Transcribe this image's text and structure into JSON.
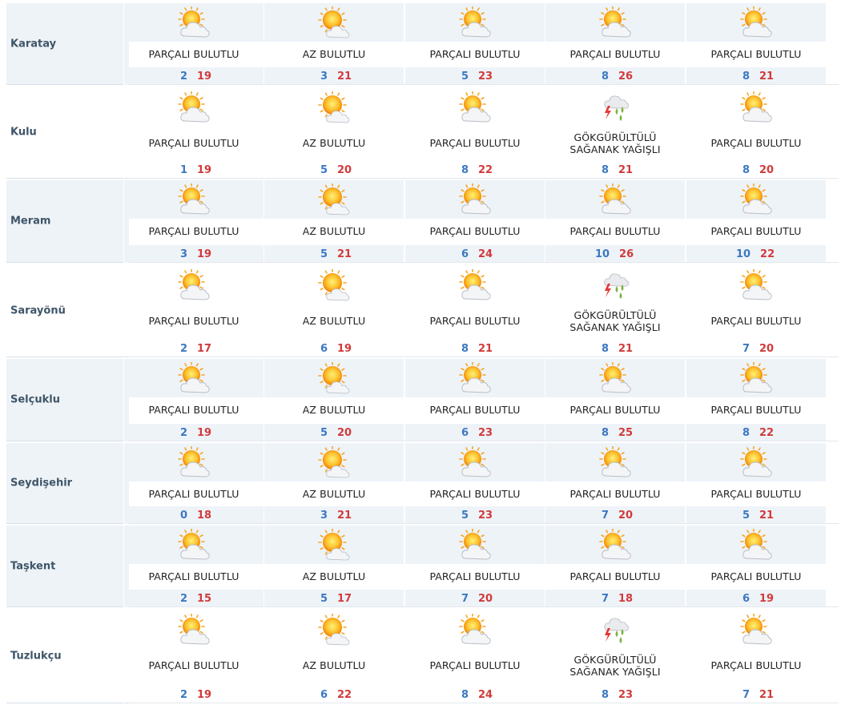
{
  "days_per_row": 5,
  "rows": [
    {
      "city": "Karatay",
      "days": [
        {
          "icon": "partly-cloudy-icon",
          "desc": [
            "PARÇALI BULUTLU"
          ],
          "min": "2",
          "max": "19"
        },
        {
          "icon": "mostly-sunny-icon",
          "desc": [
            "AZ BULUTLU"
          ],
          "min": "3",
          "max": "21"
        },
        {
          "icon": "partly-cloudy-icon",
          "desc": [
            "PARÇALI BULUTLU"
          ],
          "min": "5",
          "max": "23"
        },
        {
          "icon": "partly-cloudy-icon",
          "desc": [
            "PARÇALI BULUTLU"
          ],
          "min": "8",
          "max": "26"
        },
        {
          "icon": "partly-cloudy-icon",
          "desc": [
            "PARÇALI BULUTLU"
          ],
          "min": "8",
          "max": "21"
        }
      ]
    },
    {
      "city": "Kulu",
      "days": [
        {
          "icon": "partly-cloudy-icon",
          "desc": [
            "PARÇALI BULUTLU"
          ],
          "min": "1",
          "max": "19"
        },
        {
          "icon": "mostly-sunny-icon",
          "desc": [
            "AZ BULUTLU"
          ],
          "min": "5",
          "max": "20"
        },
        {
          "icon": "partly-cloudy-icon",
          "desc": [
            "PARÇALI BULUTLU"
          ],
          "min": "8",
          "max": "22"
        },
        {
          "icon": "thunderstorm-icon",
          "desc": [
            "GÖKGÜRÜLTÜLÜ",
            "SAĞANAK YAĞIŞLI"
          ],
          "min": "8",
          "max": "21"
        },
        {
          "icon": "partly-cloudy-icon",
          "desc": [
            "PARÇALI BULUTLU"
          ],
          "min": "8",
          "max": "20"
        }
      ]
    },
    {
      "city": "Meram",
      "days": [
        {
          "icon": "partly-cloudy-icon",
          "desc": [
            "PARÇALI BULUTLU"
          ],
          "min": "3",
          "max": "19"
        },
        {
          "icon": "mostly-sunny-icon",
          "desc": [
            "AZ BULUTLU"
          ],
          "min": "5",
          "max": "21"
        },
        {
          "icon": "partly-cloudy-icon",
          "desc": [
            "PARÇALI BULUTLU"
          ],
          "min": "6",
          "max": "24"
        },
        {
          "icon": "partly-cloudy-icon",
          "desc": [
            "PARÇALI BULUTLU"
          ],
          "min": "10",
          "max": "26"
        },
        {
          "icon": "partly-cloudy-icon",
          "desc": [
            "PARÇALI BULUTLU"
          ],
          "min": "10",
          "max": "22"
        }
      ]
    },
    {
      "city": "Sarayönü",
      "days": [
        {
          "icon": "partly-cloudy-icon",
          "desc": [
            "PARÇALI BULUTLU"
          ],
          "min": "2",
          "max": "17"
        },
        {
          "icon": "mostly-sunny-icon",
          "desc": [
            "AZ BULUTLU"
          ],
          "min": "6",
          "max": "19"
        },
        {
          "icon": "partly-cloudy-icon",
          "desc": [
            "PARÇALI BULUTLU"
          ],
          "min": "8",
          "max": "21"
        },
        {
          "icon": "thunderstorm-icon",
          "desc": [
            "GÖKGÜRÜLTÜLÜ",
            "SAĞANAK YAĞIŞLI"
          ],
          "min": "8",
          "max": "21"
        },
        {
          "icon": "partly-cloudy-icon",
          "desc": [
            "PARÇALI BULUTLU"
          ],
          "min": "7",
          "max": "20"
        }
      ]
    },
    {
      "city": "Selçuklu",
      "days": [
        {
          "icon": "partly-cloudy-icon",
          "desc": [
            "PARÇALI BULUTLU"
          ],
          "min": "2",
          "max": "19"
        },
        {
          "icon": "mostly-sunny-icon",
          "desc": [
            "AZ BULUTLU"
          ],
          "min": "5",
          "max": "20"
        },
        {
          "icon": "partly-cloudy-icon",
          "desc": [
            "PARÇALI BULUTLU"
          ],
          "min": "6",
          "max": "23"
        },
        {
          "icon": "partly-cloudy-icon",
          "desc": [
            "PARÇALI BULUTLU"
          ],
          "min": "8",
          "max": "25"
        },
        {
          "icon": "partly-cloudy-icon",
          "desc": [
            "PARÇALI BULUTLU"
          ],
          "min": "8",
          "max": "22"
        }
      ]
    },
    {
      "city": "Seydişehir",
      "days": [
        {
          "icon": "partly-cloudy-icon",
          "desc": [
            "PARÇALI BULUTLU"
          ],
          "min": "0",
          "max": "18"
        },
        {
          "icon": "mostly-sunny-icon",
          "desc": [
            "AZ BULUTLU"
          ],
          "min": "3",
          "max": "21"
        },
        {
          "icon": "partly-cloudy-icon",
          "desc": [
            "PARÇALI BULUTLU"
          ],
          "min": "5",
          "max": "23"
        },
        {
          "icon": "partly-cloudy-icon",
          "desc": [
            "PARÇALI BULUTLU"
          ],
          "min": "7",
          "max": "20"
        },
        {
          "icon": "partly-cloudy-icon",
          "desc": [
            "PARÇALI BULUTLU"
          ],
          "min": "5",
          "max": "21"
        }
      ]
    },
    {
      "city": "Taşkent",
      "days": [
        {
          "icon": "partly-cloudy-icon",
          "desc": [
            "PARÇALI BULUTLU"
          ],
          "min": "2",
          "max": "15"
        },
        {
          "icon": "mostly-sunny-icon",
          "desc": [
            "AZ BULUTLU"
          ],
          "min": "5",
          "max": "17"
        },
        {
          "icon": "partly-cloudy-icon",
          "desc": [
            "PARÇALI BULUTLU"
          ],
          "min": "7",
          "max": "20"
        },
        {
          "icon": "partly-cloudy-icon",
          "desc": [
            "PARÇALI BULUTLU"
          ],
          "min": "7",
          "max": "18"
        },
        {
          "icon": "partly-cloudy-icon",
          "desc": [
            "PARÇALI BULUTLU"
          ],
          "min": "6",
          "max": "19"
        }
      ]
    },
    {
      "city": "Tuzlukçu",
      "days": [
        {
          "icon": "partly-cloudy-icon",
          "desc": [
            "PARÇALI BULUTLU"
          ],
          "min": "2",
          "max": "19"
        },
        {
          "icon": "mostly-sunny-icon",
          "desc": [
            "AZ BULUTLU"
          ],
          "min": "6",
          "max": "22"
        },
        {
          "icon": "partly-cloudy-icon",
          "desc": [
            "PARÇALI BULUTLU"
          ],
          "min": "8",
          "max": "24"
        },
        {
          "icon": "thunderstorm-icon",
          "desc": [
            "GÖKGÜRÜLTÜLÜ",
            "SAĞANAK YAĞIŞLI"
          ],
          "min": "8",
          "max": "23"
        },
        {
          "icon": "partly-cloudy-icon",
          "desc": [
            "PARÇALI BULUTLU"
          ],
          "min": "7",
          "max": "21"
        }
      ]
    }
  ],
  "colors": {
    "min_temp": "#3b78c2",
    "max_temp": "#d13b3b",
    "city_text": "#3f5568",
    "stripe": "#eef3f8"
  }
}
